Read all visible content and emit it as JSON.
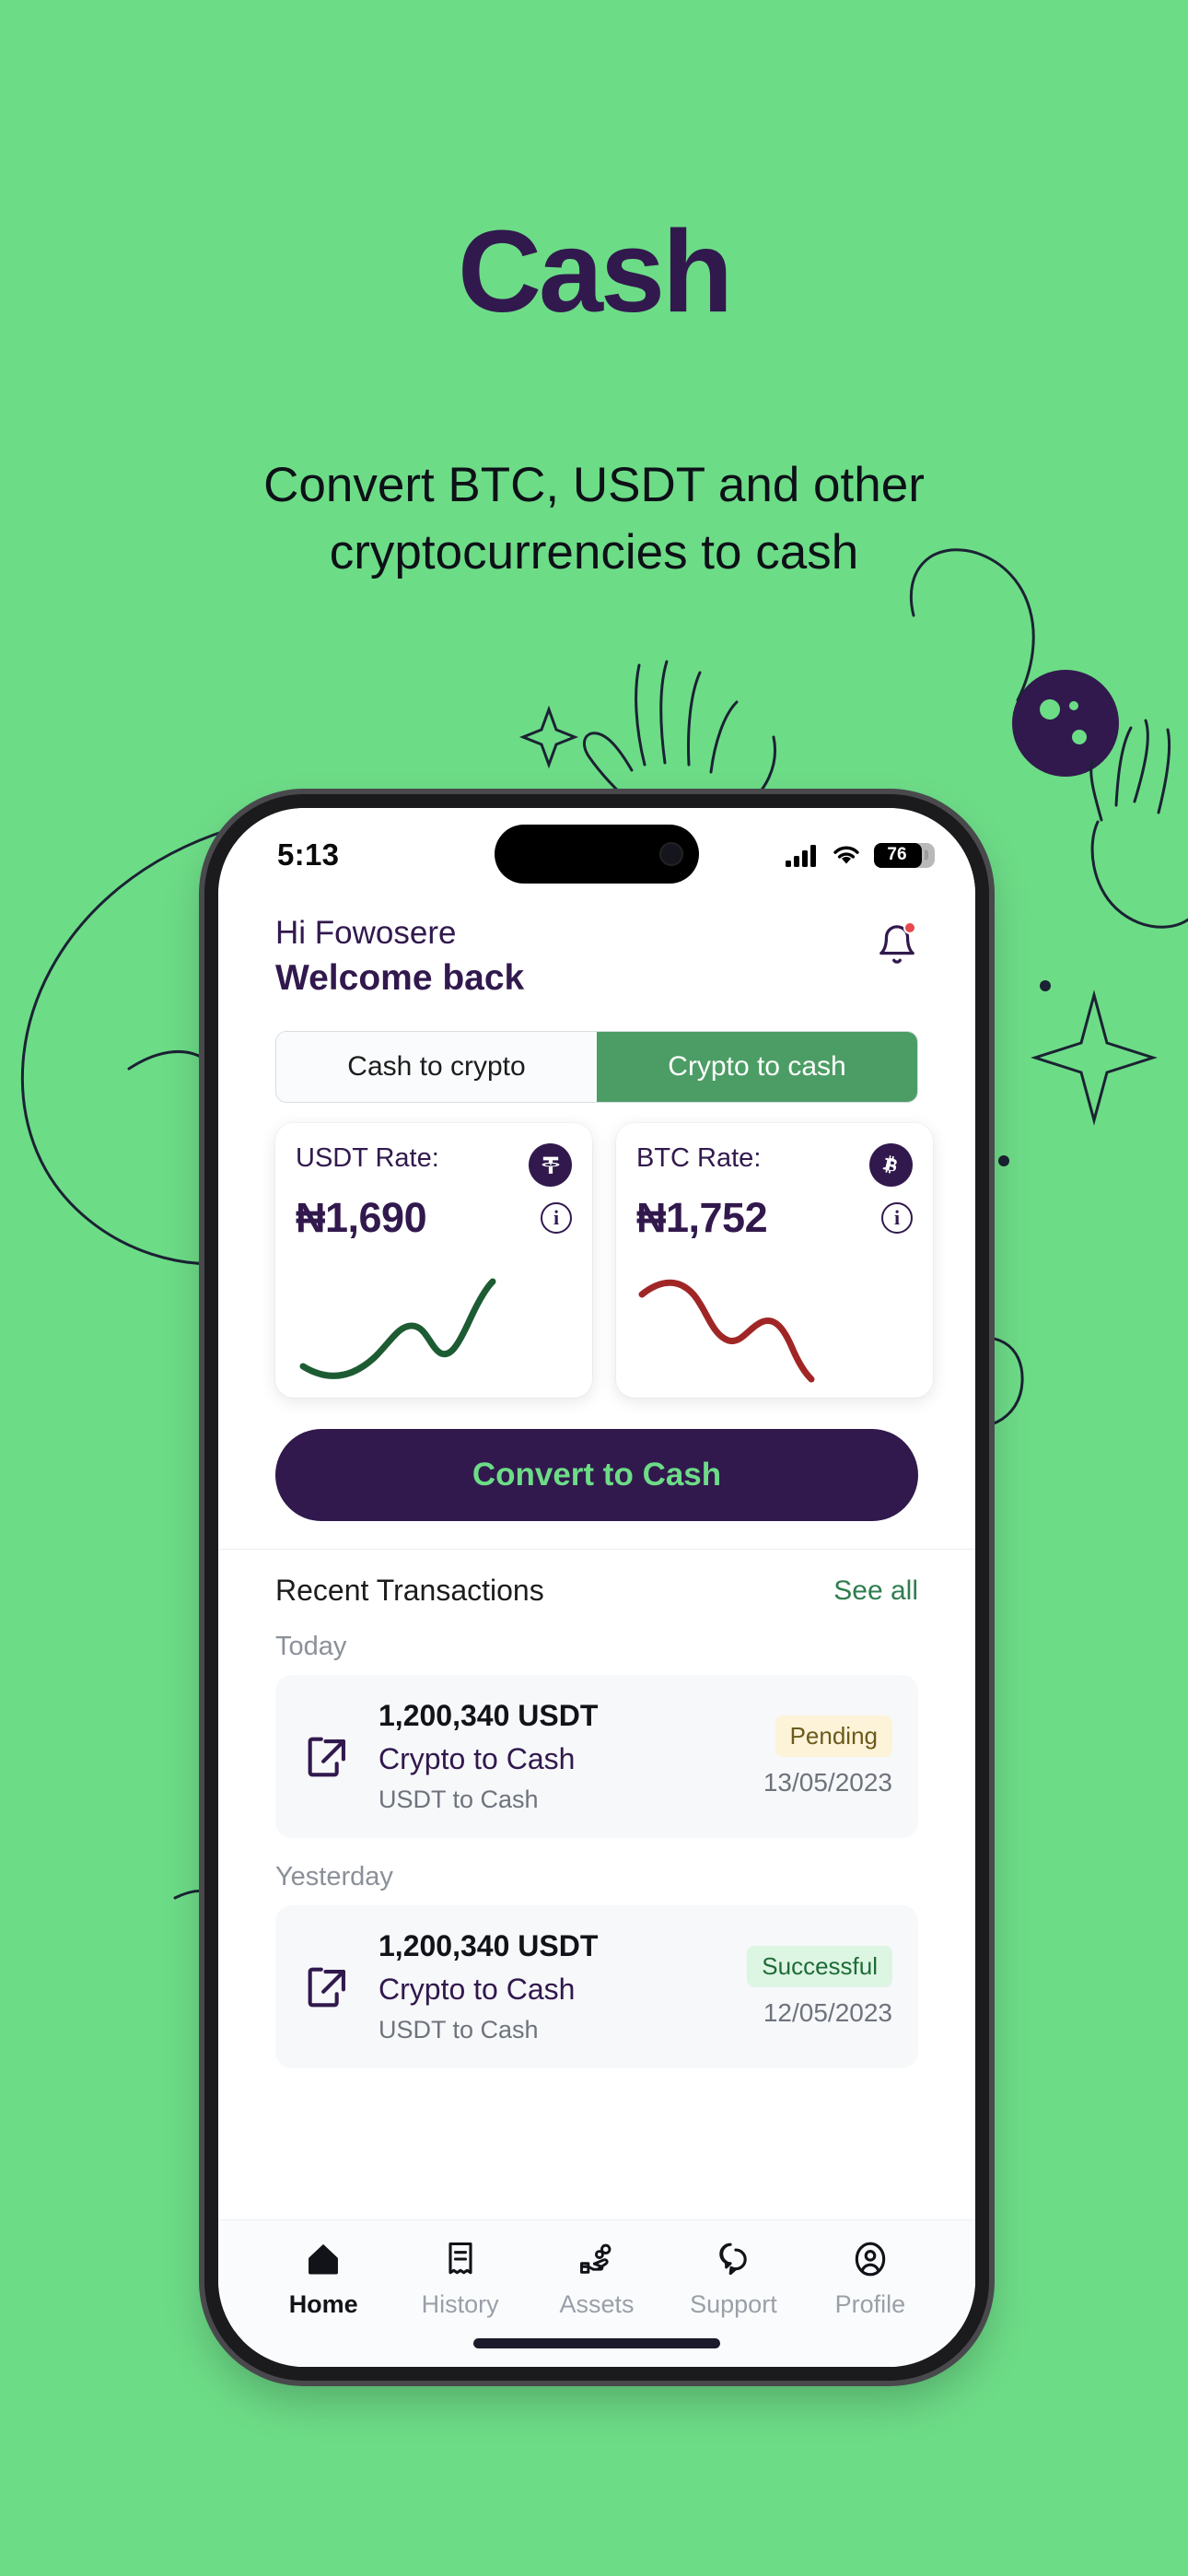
{
  "hero": {
    "title": "Cash",
    "subtitle": "Convert BTC, USDT and other cryptocurrencies to cash"
  },
  "colors": {
    "background": "#6ddc87",
    "brand_purple": "#31194d",
    "accent_green": "#4c9d65",
    "mint": "#6ddc87",
    "up_line": "#1d5c33",
    "down_line": "#a02626"
  },
  "status_bar": {
    "time": "5:13",
    "cellular_icon": "cellular-signal-icon",
    "wifi_icon": "wifi-icon",
    "battery_level": "76"
  },
  "header": {
    "greeting": "Hi Fowosere",
    "welcome": "Welcome back",
    "bell_icon": "notification-bell-icon",
    "has_notification": true
  },
  "segmented": {
    "options": [
      {
        "label": "Cash to crypto",
        "active": false
      },
      {
        "label": "Crypto to cash",
        "active": true
      }
    ]
  },
  "rate_cards": [
    {
      "label": "USDT Rate:",
      "value": "₦1,690",
      "coin_icon": "tether-icon",
      "coin_glyph": "₮",
      "info_icon": "info-icon",
      "trend": "up"
    },
    {
      "label": "BTC Rate:",
      "value": "₦1,752",
      "coin_icon": "bitcoin-icon",
      "coin_glyph": "₿",
      "info_icon": "info-icon",
      "trend": "down"
    }
  ],
  "chart_data": [
    {
      "type": "line",
      "title": "USDT Rate:",
      "series": [
        {
          "name": "USDT",
          "values": [
            18,
            22,
            19,
            14,
            8,
            4,
            10,
            17,
            13,
            20,
            2
          ]
        }
      ],
      "x": [
        0,
        1,
        2,
        3,
        4,
        5,
        6,
        7,
        8,
        9,
        10
      ],
      "color": "#1d5c33",
      "xlabel": "",
      "ylabel": "",
      "grid": false,
      "legend": "none",
      "trend": "up"
    },
    {
      "type": "line",
      "title": "BTC Rate:",
      "series": [
        {
          "name": "BTC",
          "values": [
            5,
            3,
            4,
            8,
            13,
            16,
            14,
            11,
            13,
            19,
            25
          ]
        }
      ],
      "x": [
        0,
        1,
        2,
        3,
        4,
        5,
        6,
        7,
        8,
        9,
        10
      ],
      "color": "#a02626",
      "xlabel": "",
      "ylabel": "",
      "grid": false,
      "legend": "none",
      "trend": "down"
    }
  ],
  "convert_button": {
    "label": "Convert to Cash"
  },
  "transactions": {
    "title": "Recent Transactions",
    "see_all": "See all",
    "groups": [
      {
        "day": "Today",
        "items": [
          {
            "icon": "transaction-in-icon",
            "amount": "1,200,340 USDT",
            "type": "Crypto to Cash",
            "subtitle": "USDT to Cash",
            "status": "Pending",
            "status_kind": "pending",
            "date": "13/05/2023"
          }
        ]
      },
      {
        "day": "Yesterday",
        "items": [
          {
            "icon": "transaction-in-icon",
            "amount": "1,200,340 USDT",
            "type": "Crypto to Cash",
            "subtitle": "USDT to Cash",
            "status": "Successful",
            "status_kind": "success",
            "date": "12/05/2023"
          }
        ]
      }
    ]
  },
  "bottom_nav": {
    "items": [
      {
        "label": "Home",
        "icon": "home-icon",
        "active": true
      },
      {
        "label": "History",
        "icon": "receipt-icon",
        "active": false
      },
      {
        "label": "Assets",
        "icon": "hand-coins-icon",
        "active": false
      },
      {
        "label": "Support",
        "icon": "chat-bubbles-icon",
        "active": false
      },
      {
        "label": "Profile",
        "icon": "user-circle-icon",
        "active": false
      }
    ]
  }
}
